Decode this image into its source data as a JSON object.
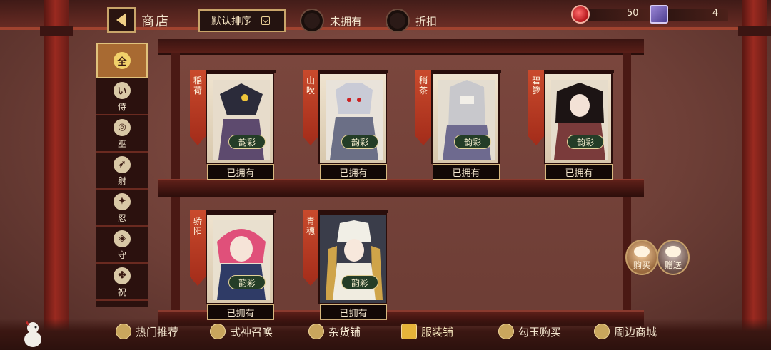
{
  "header": {
    "title": "商店",
    "sort_label": "默认排序",
    "filters": [
      "未拥有",
      "折扣"
    ]
  },
  "currency": {
    "jade": "50",
    "ticket": "4"
  },
  "sidebar": {
    "items": [
      {
        "symbol": "全",
        "label": "全",
        "active": true
      },
      {
        "symbol": "い",
        "label": "侍"
      },
      {
        "symbol": "巫",
        "label": "巫"
      },
      {
        "symbol": "射",
        "label": "射"
      },
      {
        "symbol": "忍",
        "label": "忍"
      },
      {
        "symbol": "守",
        "label": "守"
      },
      {
        "symbol": "祝",
        "label": "祝"
      }
    ]
  },
  "items": [
    {
      "name": "稲荷",
      "badge": "韵彩",
      "status": "已拥有",
      "color": "#5d4a6e"
    },
    {
      "name": "山吹",
      "badge": "韵彩",
      "status": "已拥有",
      "color": "#6b6f86"
    },
    {
      "name": "稍茶",
      "badge": "韵彩",
      "status": "已拥有",
      "color": "#6e6a8f"
    },
    {
      "name": "碧箩",
      "badge": "韵彩",
      "status": "已拥有",
      "color": "#7a3b3b"
    },
    {
      "name": "骄阳",
      "badge": "韵彩",
      "status": "已拥有",
      "color": "#d04a6a"
    },
    {
      "name": "青穗",
      "badge": "韵彩",
      "status": "已拥有",
      "color": "#cfa449"
    }
  ],
  "actions": {
    "buy": "购买",
    "gift": "赠送"
  },
  "bottom_nav": [
    "热门推荐",
    "式神召唤",
    "杂货铺",
    "服装铺",
    "勾玉购买",
    "周边商城"
  ],
  "colors": {
    "owned_bg": "#120806",
    "frame_border": "#2a0e0b",
    "gold": "#c9a56a"
  }
}
